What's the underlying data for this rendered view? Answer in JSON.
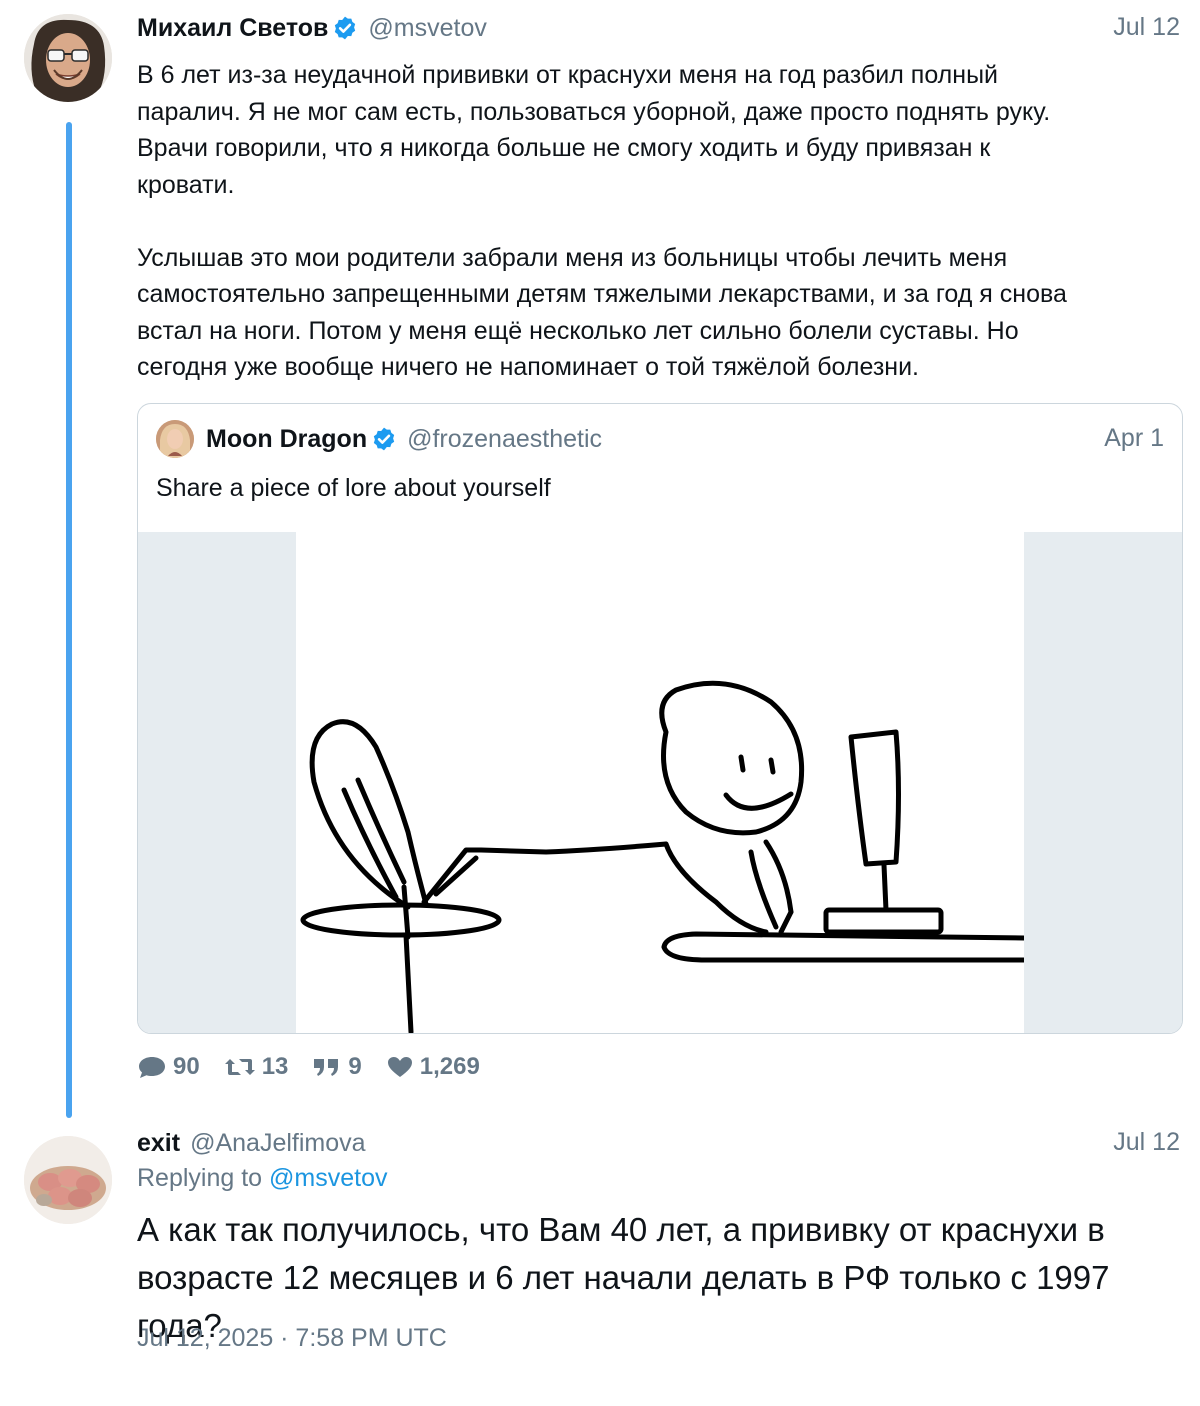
{
  "tweet1": {
    "name": "Михаил Светов",
    "handle": "@msvetov",
    "date": "Jul 12",
    "text": "В 6 лет из-за неудачной прививки от краснухи меня на год разбил полный\nпаралич. Я не мог сам есть, пользоваться уборной, даже просто поднять руку.\nВрачи говорили, что я никогда больше не смогу ходить и буду привязан к\nкровати.\n\nУслышав это мои родители забрали меня из больницы чтобы лечить меня\nсамостоятельно запрещенными детям тяжелыми лекарствами, и за год я снова\nвстал на ноги. Потом у меня ещё несколько лет сильно болели суставы. Но\nсегодня уже вообще ничего не напоминает о той тяжёлой болезни.",
    "verified": true
  },
  "quote": {
    "name": "Moon Dragon",
    "handle": "@frozenaesthetic",
    "date": "Apr 1",
    "text": "Share a piece of lore about yourself",
    "verified": true
  },
  "actions": {
    "replies": "90",
    "retweets": "13",
    "quotes": "9",
    "likes": "1,269"
  },
  "tweet2": {
    "name": "exit",
    "handle": "@AnaJelfimova",
    "date": "Jul 12",
    "replying_prefix": "Replying to",
    "replying_to": "@msvetov",
    "text": "А как так получилось, что Вам 40 лет, а прививку от краснухи в возрасте 12 месяцев и 6 лет начали делать в РФ только с 1997 года?",
    "timestamp": "Jul 12, 2025 · 7:58 PM UTC"
  },
  "colors": {
    "thread_line": "#4aa3ef",
    "verified": "#1d9bf0",
    "secondary_text": "#657786",
    "mention": "#1b95e0"
  }
}
